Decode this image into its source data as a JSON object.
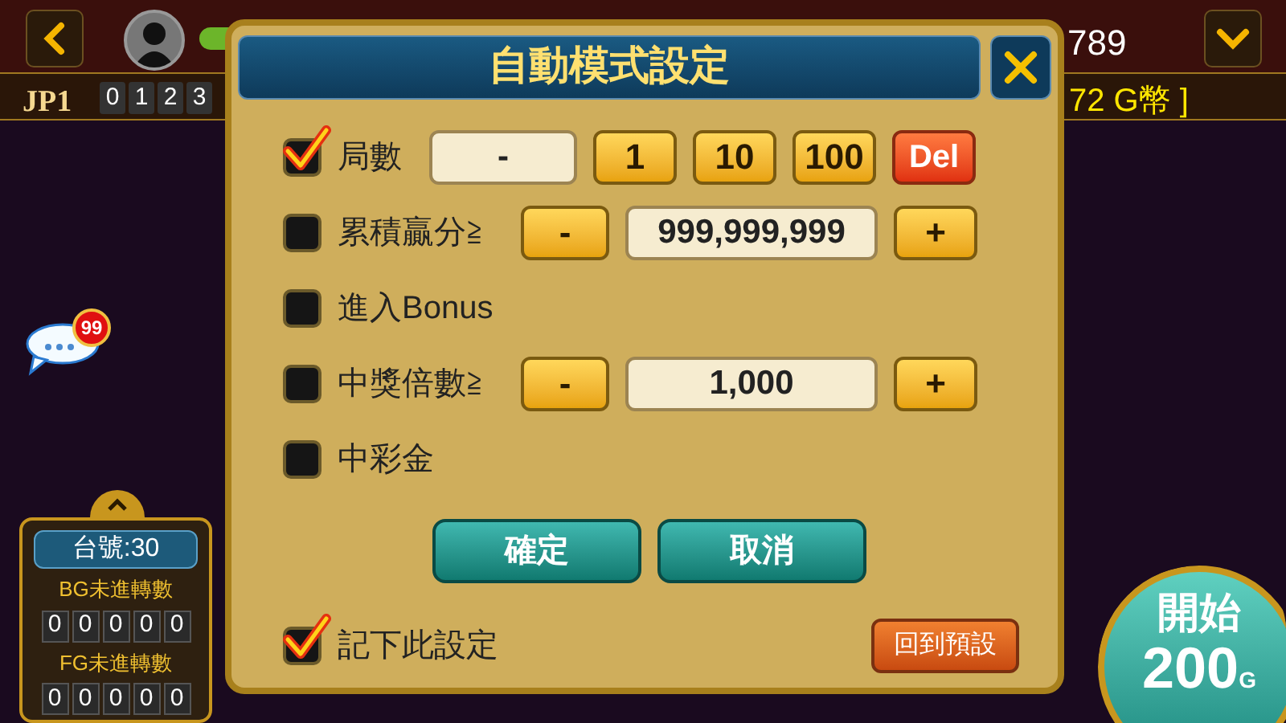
{
  "top_bar": {
    "header_number": "789"
  },
  "jackpot": {
    "label": "JP1",
    "digits": [
      "0",
      "1",
      "2",
      "3"
    ],
    "credit_text": "72 G幣 ]"
  },
  "chat": {
    "badge": "99"
  },
  "side_panel": {
    "expanded": true,
    "table_number": "台號:30",
    "counters": [
      {
        "label": "BG未進轉數",
        "digits": [
          "0",
          "0",
          "0",
          "0",
          "0"
        ]
      },
      {
        "label": "FG未進轉數",
        "digits": [
          "0",
          "0",
          "0",
          "0",
          "0"
        ]
      }
    ]
  },
  "start_button": {
    "label": "開始",
    "amount": "200",
    "unit": "G"
  },
  "dialog": {
    "title": "自動模式設定",
    "rows": [
      {
        "kind": "buttons",
        "checked": true,
        "label": "局數",
        "placeholder": "-",
        "buttons": [
          {
            "label": "1",
            "kind": "normal"
          },
          {
            "label": "10",
            "kind": "normal"
          },
          {
            "label": "100",
            "kind": "normal"
          },
          {
            "label": "Del",
            "kind": "delete"
          }
        ]
      },
      {
        "kind": "stepper",
        "checked": false,
        "label": "累積贏分≧",
        "minus": "-",
        "value": "999,999,999",
        "plus": "+"
      },
      {
        "kind": "plain",
        "checked": false,
        "label": "進入Bonus"
      },
      {
        "kind": "stepper",
        "checked": false,
        "label": "中獎倍數≧",
        "minus": "-",
        "value": "1,000",
        "plus": "+"
      },
      {
        "kind": "plain",
        "checked": false,
        "label": "中彩金"
      }
    ],
    "confirm": "確定",
    "cancel": "取消",
    "remember": {
      "checked": true,
      "label": "記下此設定"
    },
    "reset": "回到預設"
  }
}
